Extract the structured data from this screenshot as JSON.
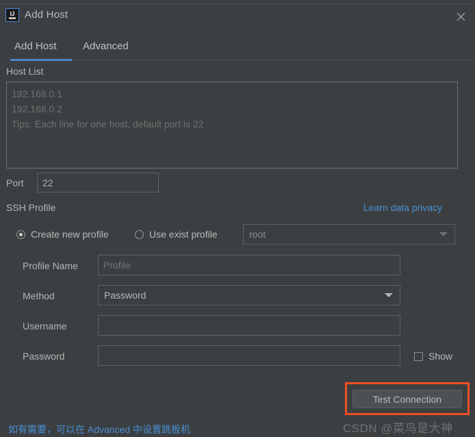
{
  "background": {
    "clipped_text": "▪ ▪ ▪ ▪ ▪ ▪ ▪ ▪ ▪ ▪ ▪ ▪ ▪ ▪ ▪",
    "strip_color": "#e8d44d"
  },
  "window": {
    "title": "Add Host",
    "app_icon": "intellij-idea-icon",
    "close_icon": "close-icon",
    "background_color": "#3c3f41"
  },
  "tabs": {
    "items": [
      {
        "label": "Add Host",
        "active": true
      },
      {
        "label": "Advanced",
        "active": false
      }
    ],
    "active_color": "#4a88c7"
  },
  "host_list": {
    "label": "Host List",
    "placeholder": "192.168.0.1\n192.168.0.2\nTips: Each line for one host, default port is 22",
    "value": ""
  },
  "port": {
    "label": "Port",
    "value": "22"
  },
  "ssh_profile": {
    "section_label": "SSH Profile",
    "privacy_link": "Learn data privacy",
    "link_color": "#4a8fd4",
    "radio_create_new": "Create new profile",
    "radio_use_exist": "Use exist profile",
    "selected": "create_new",
    "existing_profile": {
      "selected": "root",
      "options": [
        "root"
      ],
      "enabled": false
    }
  },
  "form": {
    "profile_name": {
      "label": "Profile Name",
      "value": "",
      "placeholder": "Profile"
    },
    "method": {
      "label": "Method",
      "selected": "Password",
      "options": [
        "Password"
      ]
    },
    "username": {
      "label": "Username",
      "value": "",
      "placeholder": ""
    },
    "password": {
      "label": "Password",
      "value": "",
      "placeholder": ""
    },
    "show_password": {
      "label": "Show",
      "checked": false
    }
  },
  "footer": {
    "hint_link": "如有需要，可以在 Advanced 中设置跳板机",
    "test_button": "Test Connection",
    "highlight_color": "#f04e23"
  },
  "watermark": {
    "text": "CSDN @菜鸟是大神"
  }
}
